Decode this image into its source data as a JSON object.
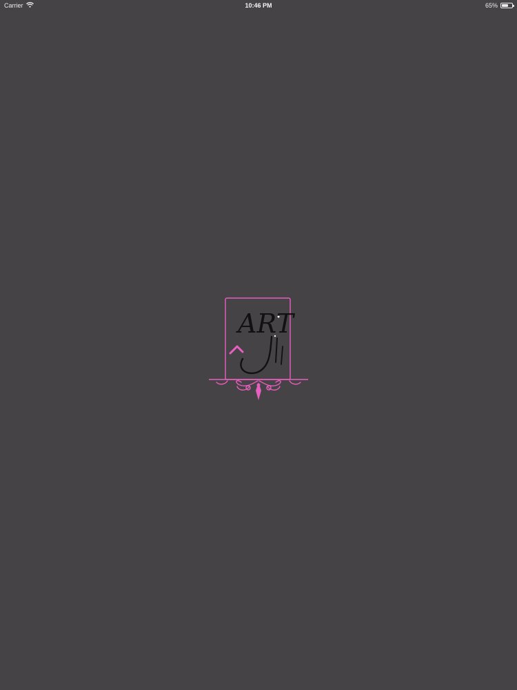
{
  "status_bar": {
    "carrier": "Carrier",
    "wifi_icon": "wifi-icon",
    "time": "10:46 PM",
    "battery_percent_text": "65%",
    "battery_level": 0.65,
    "battery_icon": "battery-icon"
  },
  "splash": {
    "logo_icon": "art-calligraphy-logo",
    "logo_text": "ART",
    "logo_text_ar": "آرت"
  },
  "colors": {
    "background": "#454345",
    "accent_pink": "#e85fc0",
    "logo_ink": "#111111"
  }
}
